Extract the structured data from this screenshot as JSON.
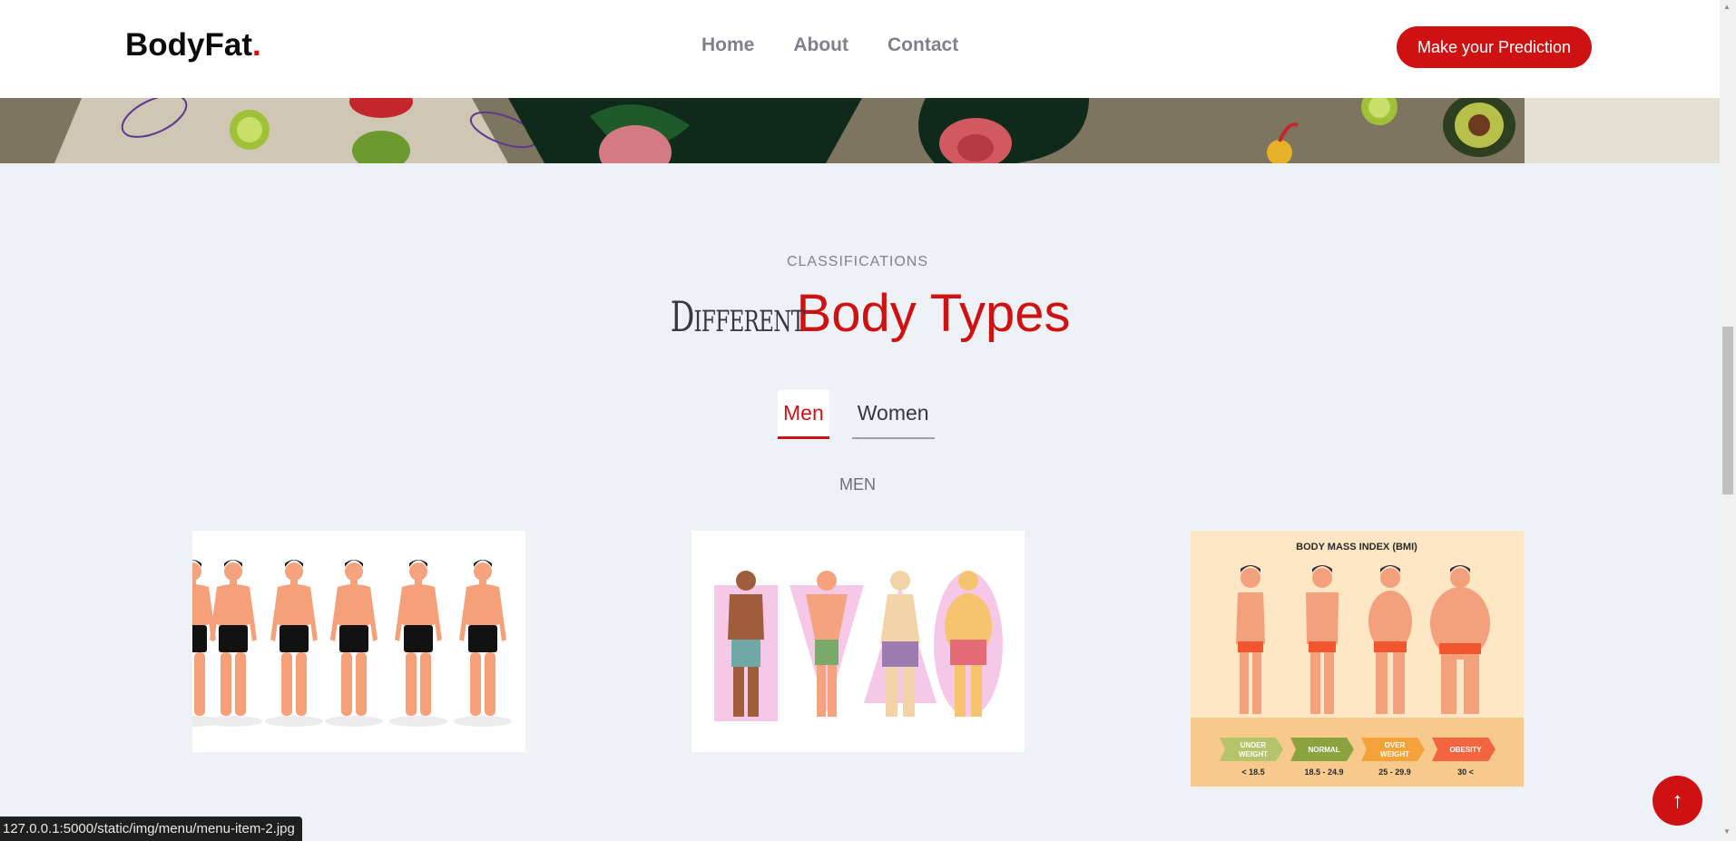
{
  "header": {
    "logo_text": "BodyFat",
    "logo_dot": ".",
    "nav": [
      {
        "label": "Home"
      },
      {
        "label": "About"
      },
      {
        "label": "Contact"
      }
    ],
    "cta_label": "Make your Prediction"
  },
  "section": {
    "subtitle": "CLASSIFICATIONS",
    "title_thin": "Different",
    "title_accent": "Body Types",
    "tabs": [
      {
        "label": "Men",
        "active": true
      },
      {
        "label": "Women",
        "active": false
      }
    ],
    "tab_caption": "MEN"
  },
  "cards": [
    {
      "name": "men-body-fat-levels-image"
    },
    {
      "name": "men-body-shapes-image"
    },
    {
      "name": "bmi-chart-image",
      "heading": "BODY MASS INDEX (BMI)",
      "categories": [
        {
          "label_line1": "UNDER",
          "label_line2": "WEIGHT",
          "range": "< 18.5",
          "color": "#b5c36a"
        },
        {
          "label_line1": "NORMAL",
          "label_line2": "",
          "range": "18.5 - 24.9",
          "color": "#8aa33d"
        },
        {
          "label_line1": "OVER",
          "label_line2": "WEIGHT",
          "range": "25 - 29.9",
          "color": "#f4a23a"
        },
        {
          "label_line1": "OBESITY",
          "label_line2": "",
          "range": "30 <",
          "color": "#f2653f"
        }
      ]
    }
  ],
  "status_bar": {
    "url": "127.0.0.1:5000/static/img/menu/menu-item-2.jpg"
  },
  "back_to_top": {
    "icon": "arrow-up-icon",
    "glyph": "↑"
  },
  "colors": {
    "accent": "#ce1212",
    "background": "#eef1f5"
  }
}
